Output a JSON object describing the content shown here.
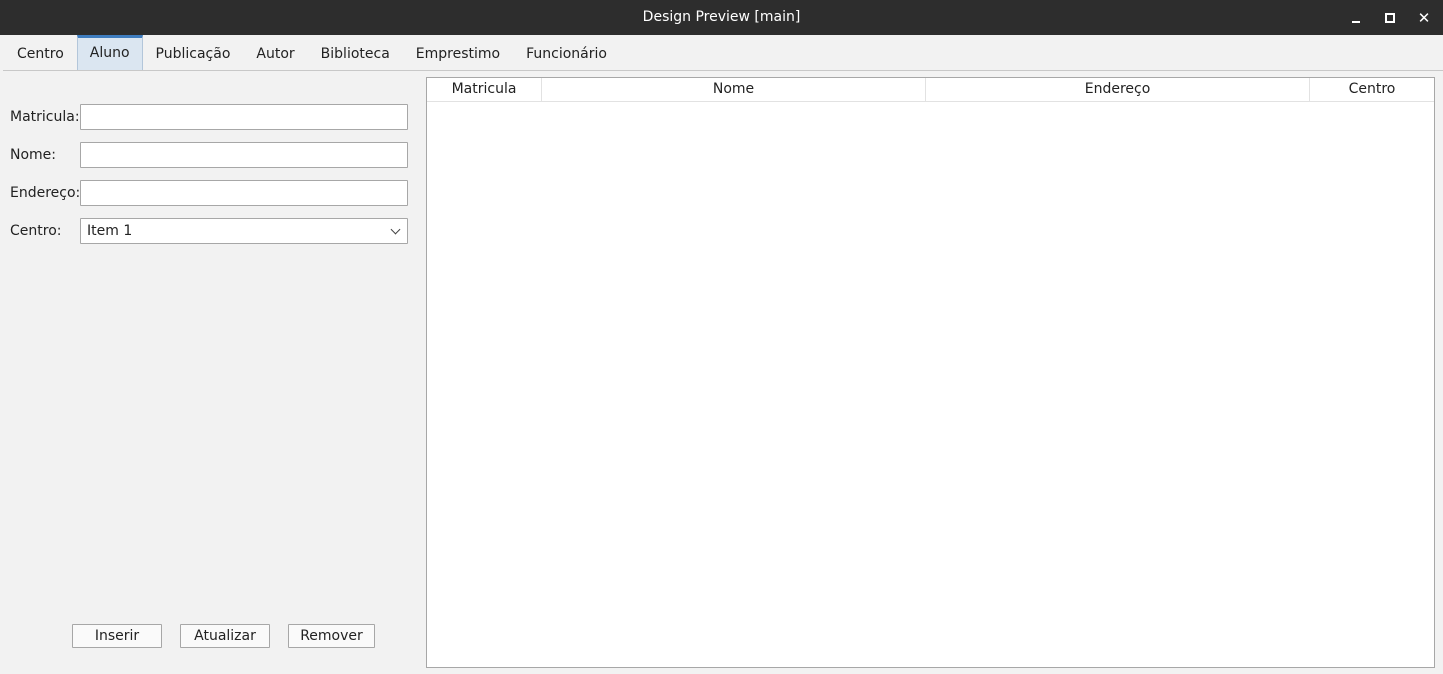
{
  "window": {
    "title": "Design Preview [main]"
  },
  "tabs": [
    {
      "label": "Centro"
    },
    {
      "label": "Aluno",
      "active": true
    },
    {
      "label": "Publicação"
    },
    {
      "label": "Autor"
    },
    {
      "label": "Biblioteca"
    },
    {
      "label": "Emprestimo"
    },
    {
      "label": "Funcionário"
    }
  ],
  "form": {
    "matricula_label": "Matricula:",
    "matricula_value": "",
    "nome_label": "Nome:",
    "nome_value": "",
    "endereco_label": "Endereço:",
    "endereco_value": "",
    "centro_label": "Centro:",
    "centro_selected": "Item 1"
  },
  "buttons": {
    "inserir": "Inserir",
    "atualizar": "Atualizar",
    "remover": "Remover"
  },
  "table": {
    "columns": [
      "Matricula",
      "Nome",
      "Endereço",
      "Centro"
    ],
    "rows": []
  },
  "colors": {
    "titlebar": "#2d2d2d",
    "active_tab_accent": "#3f7dbf",
    "window_bg": "#f2f2f2"
  },
  "icons": {
    "minimize": "minimize-icon",
    "maximize": "maximize-icon",
    "close": "close-icon",
    "dropdown": "chevron-down-icon"
  }
}
